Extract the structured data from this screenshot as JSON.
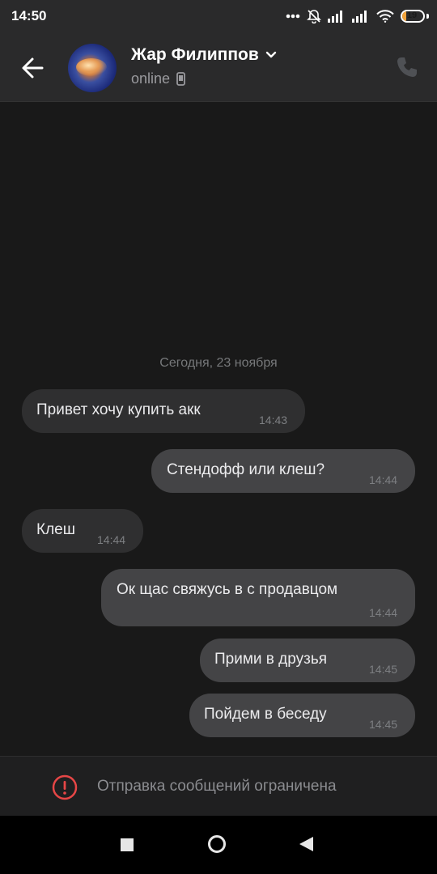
{
  "status_bar": {
    "time": "14:50",
    "battery": "19",
    "battery_level": 0.19
  },
  "header": {
    "contact_name": "Жар Филиппов",
    "status": "online"
  },
  "chat": {
    "date_separator": "Сегодня, 23 ноября",
    "messages": [
      {
        "direction": "in",
        "text": "Привет хочу купить акк",
        "time": "14:43"
      },
      {
        "direction": "out",
        "text": "Стендофф или клеш?",
        "time": "14:44"
      },
      {
        "direction": "in",
        "text": "Клеш",
        "time": "14:44"
      },
      {
        "direction": "out",
        "text": "Ок щас свяжусь в с продавцом",
        "time": "14:44"
      },
      {
        "direction": "out",
        "text": "Прими в друзья",
        "time": "14:45"
      },
      {
        "direction": "out",
        "text": "Пойдем в беседу",
        "time": "14:45"
      }
    ]
  },
  "restriction": {
    "text": "Отправка сообщений ограничена",
    "icon": "alert-circle-icon",
    "color": "#e64646"
  },
  "colors": {
    "background": "#191919",
    "header": "#2a2a2b",
    "incoming_bubble": "#2f2f30",
    "outgoing_bubble": "#444446"
  }
}
